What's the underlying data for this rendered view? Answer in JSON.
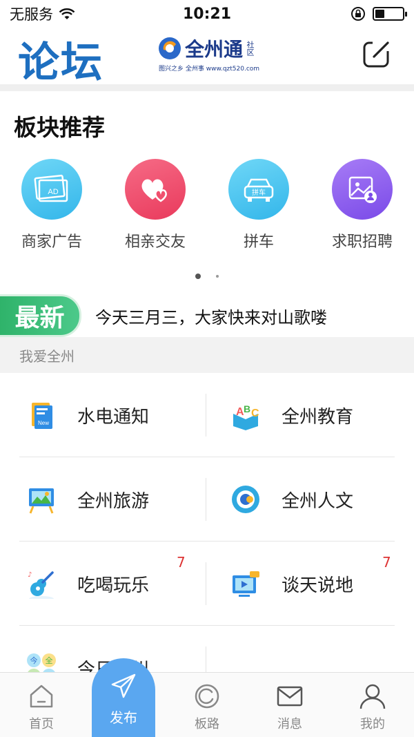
{
  "status_bar": {
    "carrier": "无服务",
    "time": "10:21",
    "battery_level": 0.35
  },
  "header": {
    "title": "论坛",
    "logo": {
      "name": "全州通",
      "suffix": "社区",
      "slogan": "图兴之乡 全州事 www.qzt520.com"
    }
  },
  "recommend": {
    "title": "板块推荐",
    "categories": [
      {
        "label": "商家广告",
        "icon": "ad-icon",
        "color": "#4fc6ef"
      },
      {
        "label": "相亲交友",
        "icon": "hearts-icon",
        "color": "#f0506e"
      },
      {
        "label": "拼车",
        "icon": "car-icon",
        "color": "#4fc6ef"
      },
      {
        "label": "求职招聘",
        "icon": "job-icon",
        "color": "#8b5cf0"
      }
    ],
    "page_count": 2,
    "current_page": 1
  },
  "news": {
    "badge": "最新",
    "text": "今天三月三，大家快来对山歌喽"
  },
  "group": {
    "title": "我爱全州",
    "rows": [
      [
        {
          "label": "水电通知",
          "icon": "notebook-icon",
          "badge": ""
        },
        {
          "label": "全州教育",
          "icon": "abc-icon",
          "badge": ""
        }
      ],
      [
        {
          "label": "全州旅游",
          "icon": "easel-icon",
          "badge": ""
        },
        {
          "label": "全州人文",
          "icon": "circle-icon",
          "badge": ""
        }
      ],
      [
        {
          "label": "吃喝玩乐",
          "icon": "guitar-icon",
          "badge": "7"
        },
        {
          "label": "谈天说地",
          "icon": "monitor-icon",
          "badge": "7"
        }
      ],
      [
        {
          "label": "今日全州",
          "icon": "today-icon",
          "badge": ""
        },
        {
          "label": "",
          "icon": "",
          "badge": ""
        }
      ]
    ]
  },
  "bottom_nav": {
    "home": "首页",
    "publish": "发布",
    "boards": "板路",
    "messages": "消息",
    "mine": "我的"
  }
}
